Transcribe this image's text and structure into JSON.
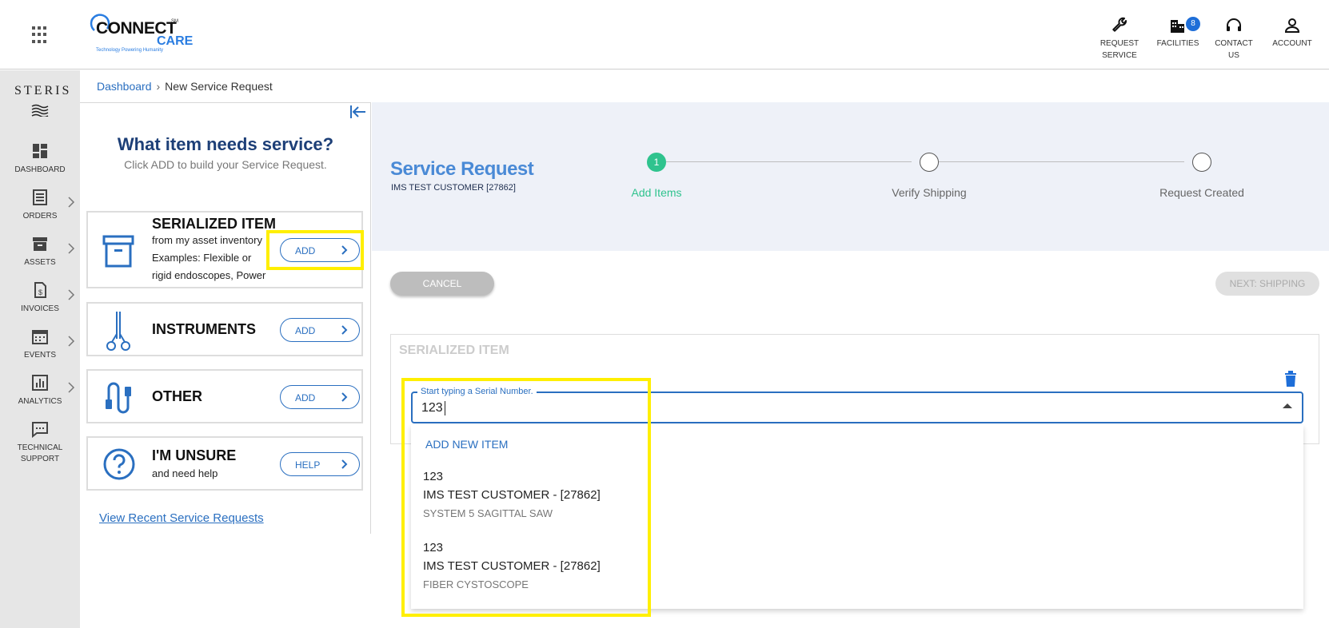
{
  "header": {
    "logo": {
      "brand_top": "CONNECT",
      "brand_bottom": "CARE",
      "mark": "SM",
      "tagline": "Technology Powering Humanity"
    },
    "nav": [
      {
        "label": "REQUEST\nSERVICE",
        "icon": "wrench-icon"
      },
      {
        "label": "FACILITIES",
        "icon": "building-icon",
        "badge": "8"
      },
      {
        "label": "CONTACT\nUS",
        "icon": "headset-icon"
      },
      {
        "label": "ACCOUNT",
        "icon": "user-icon"
      }
    ]
  },
  "sidebar": {
    "brand": "STERIS",
    "items": [
      {
        "label": "DASHBOARD",
        "icon": "dashboard-icon"
      },
      {
        "label": "ORDERS",
        "icon": "list-icon"
      },
      {
        "label": "ASSETS",
        "icon": "archive-icon"
      },
      {
        "label": "INVOICES",
        "icon": "invoice-icon"
      },
      {
        "label": "EVENTS",
        "icon": "calendar-icon"
      },
      {
        "label": "ANALYTICS",
        "icon": "chart-icon"
      },
      {
        "label": "TECHNICAL\nSUPPORT",
        "icon": "chat-icon"
      }
    ]
  },
  "breadcrumb": {
    "home": "Dashboard",
    "current": "New Service Request"
  },
  "left_panel": {
    "title": "What item needs service?",
    "subtitle": "Click ADD to build your Service Request.",
    "cards": [
      {
        "name": "SERIALIZED ITEM",
        "desc_lines": [
          "from my asset inventory",
          "Examples: Flexible or",
          "rigid endoscopes, Power"
        ],
        "button": "ADD",
        "icon": "archive-box-icon"
      },
      {
        "name": "INSTRUMENTS",
        "button": "ADD",
        "icon": "forceps-icon"
      },
      {
        "name": "OTHER",
        "button": "ADD",
        "icon": "cable-icon"
      },
      {
        "name": "I'M UNSURE",
        "desc_lines": [
          "and need help"
        ],
        "button": "HELP",
        "icon": "question-icon"
      }
    ],
    "recent_link": "View Recent Service Requests"
  },
  "service_request": {
    "title": "Service Request",
    "customer": "IMS TEST CUSTOMER [27862]",
    "steps": [
      {
        "number": "1",
        "label": "Add Items",
        "active": true
      },
      {
        "number": "",
        "label": "Verify Shipping",
        "active": false
      },
      {
        "number": "",
        "label": "Request Created",
        "active": false
      }
    ],
    "cancel_label": "CANCEL",
    "next_label": "NEXT: SHIPPING"
  },
  "serialized_section": {
    "title": "SERIALIZED ITEM",
    "field_label": "Start typing a Serial Number.",
    "field_value": "123",
    "dropdown": {
      "add_new": "ADD NEW ITEM",
      "options": [
        {
          "serial": "123",
          "customer": "IMS TEST CUSTOMER - [27862]",
          "model": "SYSTEM 5 SAGITTAL SAW"
        },
        {
          "serial": "123",
          "customer": "IMS TEST CUSTOMER - [27862]",
          "model": "FIBER CYSTOSCOPE"
        }
      ]
    }
  },
  "colors": {
    "accent": "#2a6fc0",
    "step_active": "#2fc38e",
    "highlight": "#ffef00",
    "title_navy": "#1d3f77"
  }
}
